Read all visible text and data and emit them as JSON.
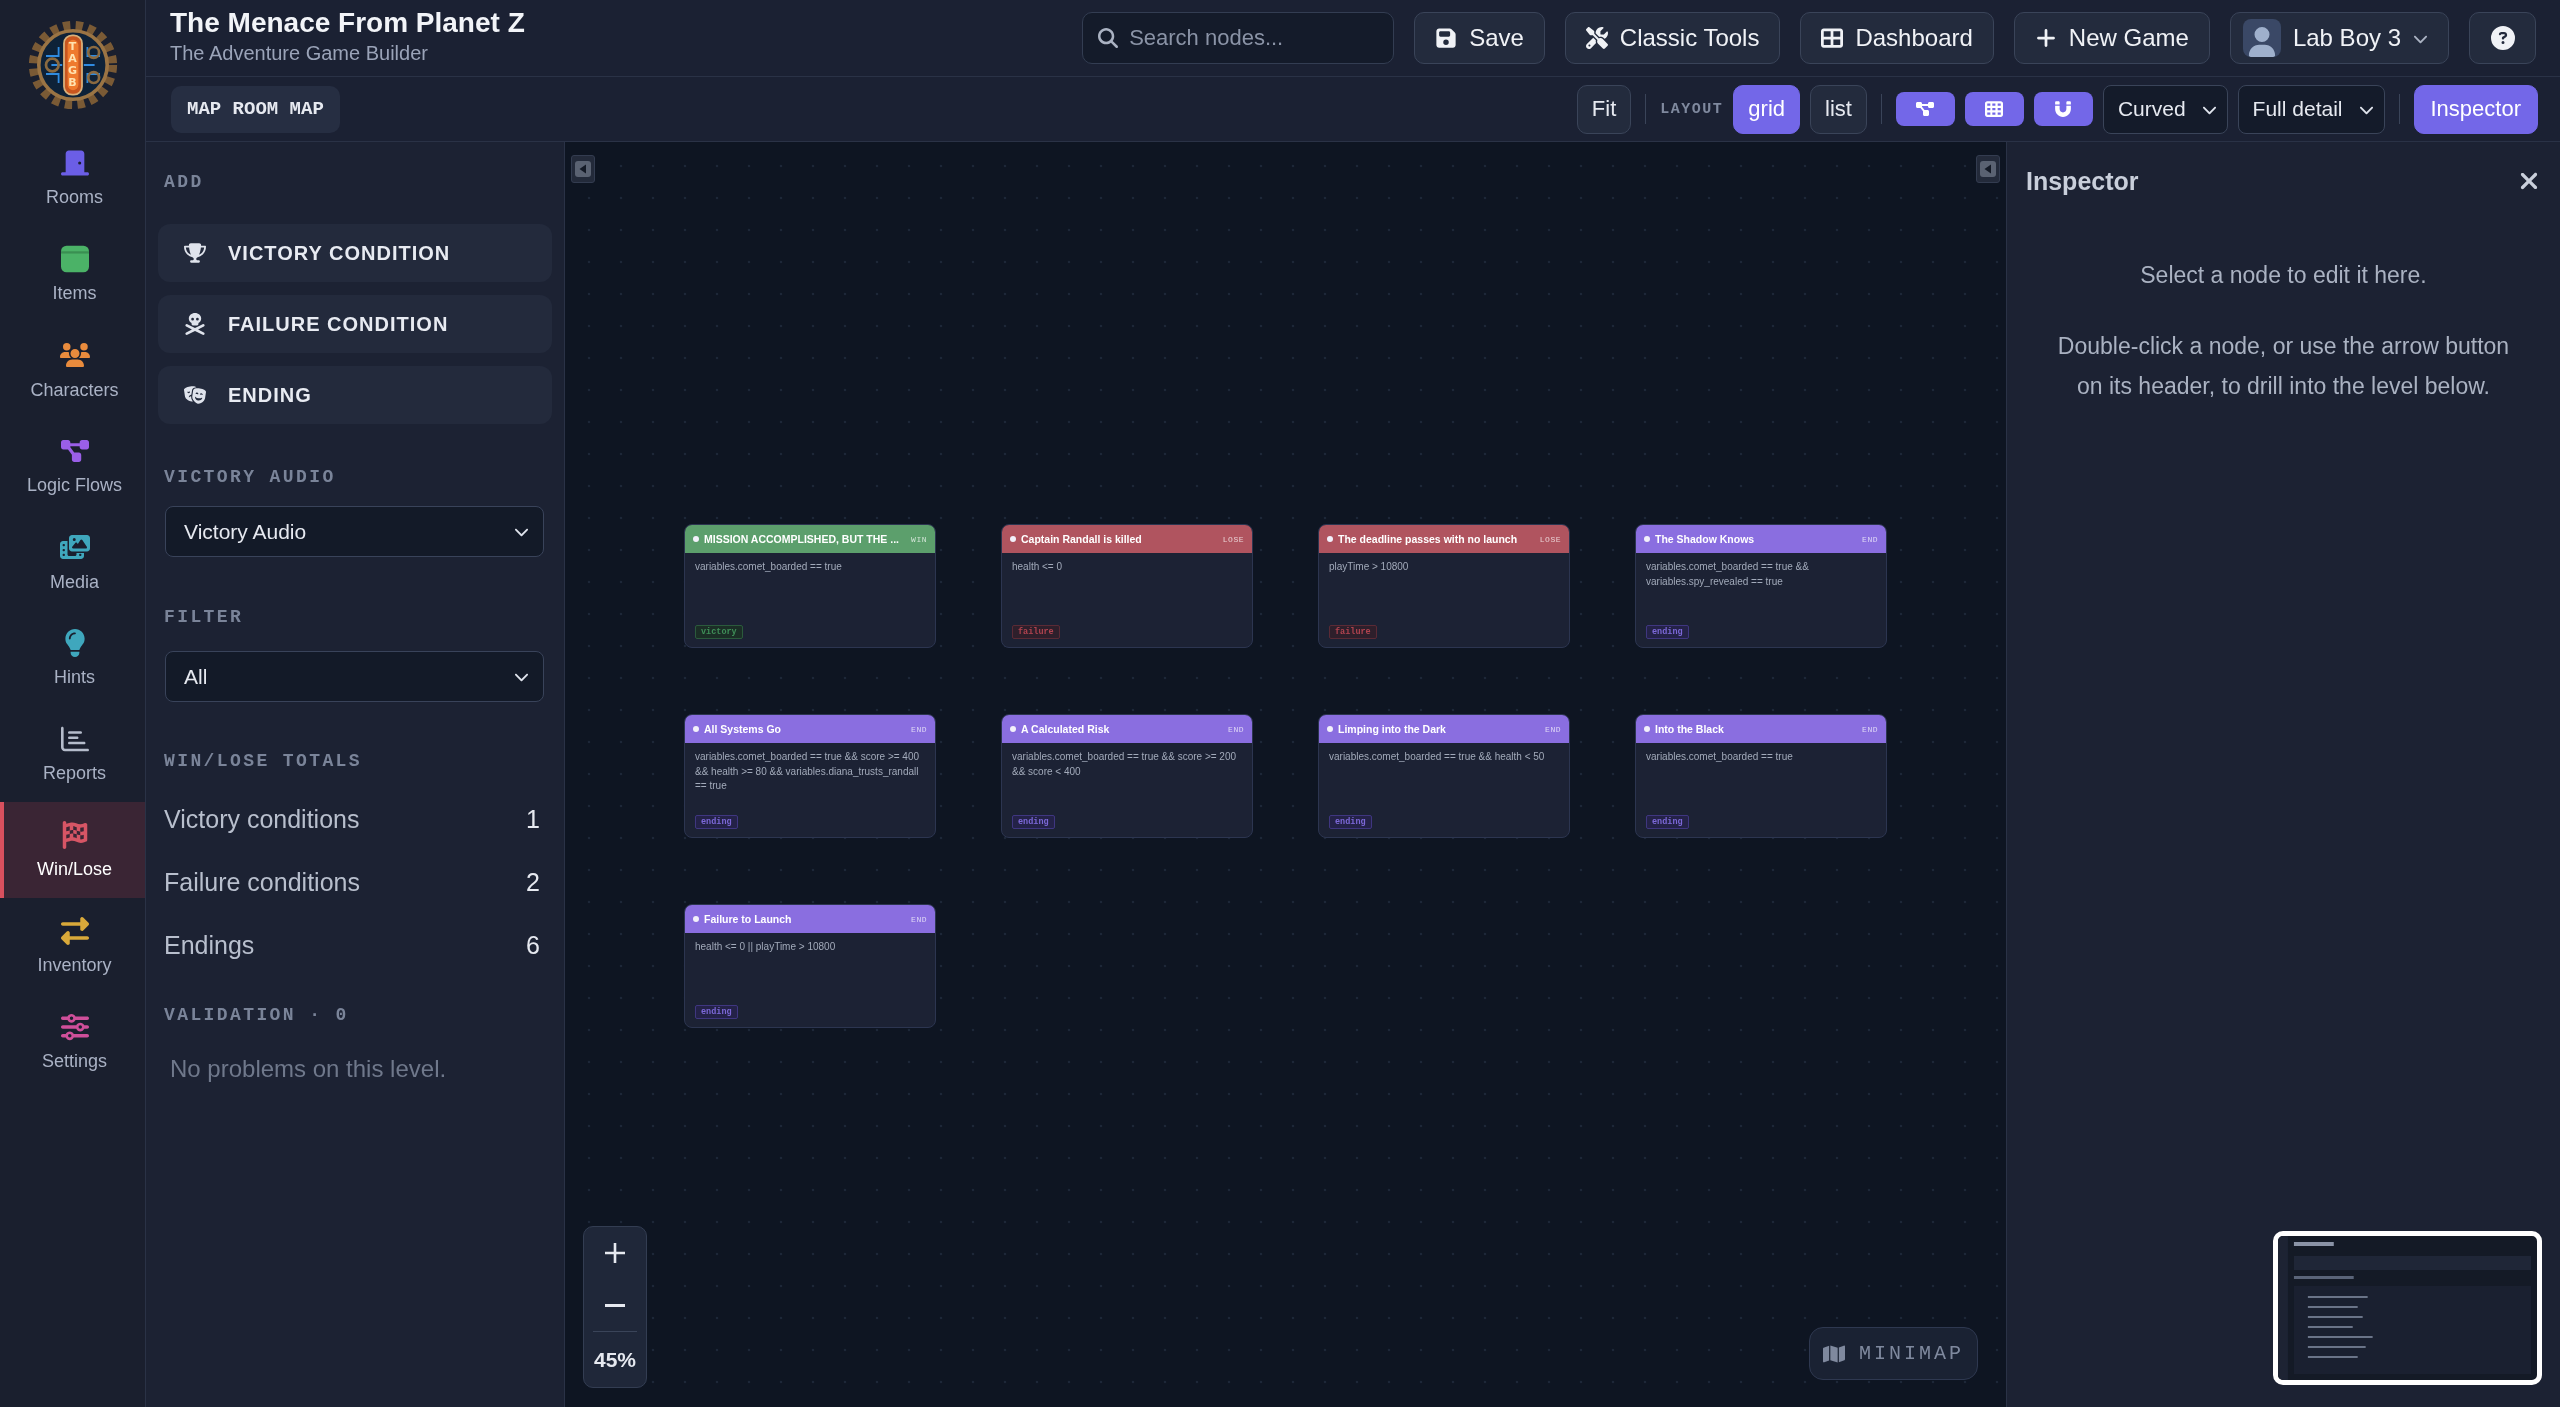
{
  "logo": {
    "letters": "TAGB"
  },
  "nav": [
    {
      "label": "Rooms",
      "selected": false
    },
    {
      "label": "Items",
      "selected": false
    },
    {
      "label": "Characters",
      "selected": false
    },
    {
      "label": "Logic Flows",
      "selected": false
    },
    {
      "label": "Media",
      "selected": false
    },
    {
      "label": "Hints",
      "selected": false
    },
    {
      "label": "Reports",
      "selected": false
    },
    {
      "label": "Win/Lose",
      "selected": true
    },
    {
      "label": "Inventory",
      "selected": false
    },
    {
      "label": "Settings",
      "selected": false
    }
  ],
  "header": {
    "title": "The Menace From Planet Z",
    "subtitle": "The Adventure Game Builder",
    "search": {
      "placeholder": "Search nodes..."
    },
    "buttons": [
      {
        "label": "Save"
      },
      {
        "label": "Classic Tools"
      },
      {
        "label": "Dashboard"
      },
      {
        "label": "New Game"
      }
    ],
    "user": {
      "name": "Lab Boy 3"
    }
  },
  "breadcrumb": "MAP ROOM MAP",
  "toolbar": {
    "fit": "Fit",
    "layout_label": "LAYOUT",
    "layouts": [
      {
        "label": "grid",
        "selected": true
      },
      {
        "label": "list",
        "selected": false
      }
    ],
    "toggles": [
      {
        "on": true
      },
      {
        "on": true
      },
      {
        "on": true
      }
    ],
    "edge_style": "Curved",
    "detail": "Full detail",
    "inspector": {
      "label": "Inspector",
      "on": true
    }
  },
  "left_panel": {
    "add": {
      "label": "ADD",
      "buttons": [
        "VICTORY CONDITION",
        "FAILURE CONDITION",
        "ENDING"
      ]
    },
    "victory_audio": {
      "label": "VICTORY AUDIO",
      "value": "Victory Audio"
    },
    "filter": {
      "label": "FILTER",
      "value": "All"
    },
    "totals": {
      "label": "WIN/LOSE TOTALS",
      "rows": [
        {
          "label": "Victory conditions",
          "count": "1"
        },
        {
          "label": "Failure conditions",
          "count": "2"
        },
        {
          "label": "Endings",
          "count": "6"
        }
      ]
    },
    "validation": {
      "label": "VALIDATION · 0",
      "message": "No problems on this level."
    }
  },
  "canvas": {
    "nodes": [
      {
        "kind": "win",
        "title": "MISSION ACCOMPLISHED, BUT THE ...",
        "badge": "WIN",
        "condition": "variables.comet_boarded == true",
        "tag": "victory"
      },
      {
        "kind": "lose",
        "title": "Captain Randall is killed",
        "badge": "LOSE",
        "condition": "health <= 0",
        "tag": "failure"
      },
      {
        "kind": "lose",
        "title": "The deadline passes with no launch",
        "badge": "LOSE",
        "condition": "playTime > 10800",
        "tag": "failure"
      },
      {
        "kind": "end",
        "title": "The Shadow Knows",
        "badge": "END",
        "condition": "variables.comet_boarded == true && variables.spy_revealed == true",
        "tag": "ending"
      },
      {
        "kind": "end",
        "title": "All Systems Go",
        "badge": "END",
        "condition": "variables.comet_boarded == true && score >= 400 && health >= 80 && variables.diana_trusts_randall == true",
        "tag": "ending"
      },
      {
        "kind": "end",
        "title": "A Calculated Risk",
        "badge": "END",
        "condition": "variables.comet_boarded == true && score >= 200 && score < 400",
        "tag": "ending"
      },
      {
        "kind": "end",
        "title": "Limping into the Dark",
        "badge": "END",
        "condition": "variables.comet_boarded == true && health < 50",
        "tag": "ending"
      },
      {
        "kind": "end",
        "title": "Into the Black",
        "badge": "END",
        "condition": "variables.comet_boarded == true",
        "tag": "ending"
      },
      {
        "kind": "end",
        "title": "Failure to Launch",
        "badge": "END",
        "condition": "health <= 0 || playTime > 10800",
        "tag": "ending"
      }
    ],
    "zoom": "45%",
    "minimap": "MINIMAP"
  },
  "inspector": {
    "title": "Inspector",
    "empty_title": "Select a node to edit it here.",
    "hint": "Double-click a node, or use the arrow button on its header, to drill into the level below."
  }
}
